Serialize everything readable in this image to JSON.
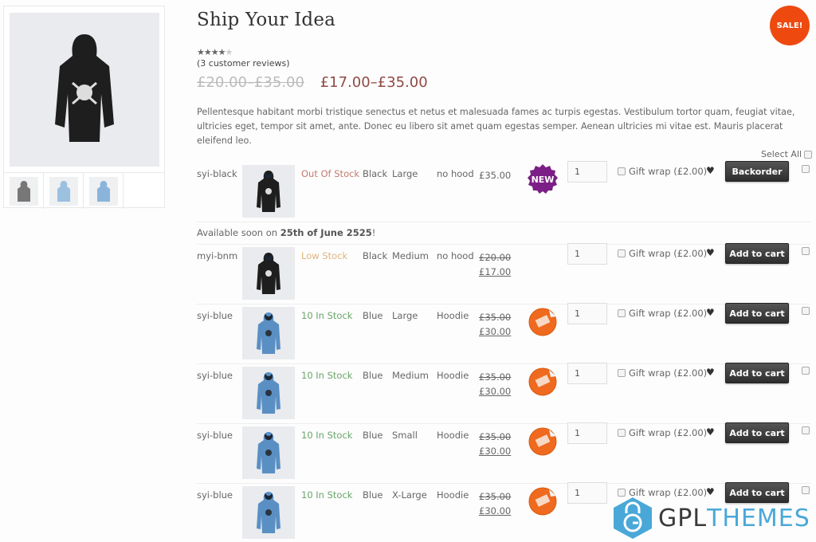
{
  "product": {
    "title": "Ship Your Idea",
    "sale_badge": "SALE!",
    "rating_stars_filled": "★★★★",
    "rating_stars_empty": "★",
    "rating": 4,
    "rating_max": 5,
    "reviews": "(3 customer reviews)",
    "price_old": "£20.00–£35.00",
    "price_new": "£17.00–£35.00",
    "description": "Pellentesque habitant morbi tristique senectus et netus et malesuada fames ac turpis egestas. Vestibulum tortor quam, feugiat vitae, ultricies eget, tempor sit amet, ante. Donec eu libero sit amet quam egestas semper. Aenean ultricies mi vitae est. Mauris placerat eleifend leo."
  },
  "gallery": {
    "main_image": "black-hoodie",
    "thumbs": [
      "grey-hoodie",
      "blue-hoodie",
      "blue-hoodie-2"
    ]
  },
  "table": {
    "select_all_label": "Select All",
    "availability_prefix": "Available soon on ",
    "availability_date": "25th of June 2525",
    "availability_suffix": "!",
    "rows": [
      {
        "sku": "syi-black",
        "image": "black-hoodie",
        "stock": "Out Of Stock",
        "stock_status": "out",
        "color": "Black",
        "size": "Large",
        "style": "no hood",
        "price_regular": "£35.00",
        "price_sale": "",
        "badge": "NEW",
        "qty": "1",
        "gift_label": "Gift wrap (£2.00)",
        "button": "Backorder"
      },
      {
        "sku": "myi-bnm",
        "image": "black-hoodie",
        "stock": "Low Stock",
        "stock_status": "low",
        "color": "Black",
        "size": "Medium",
        "style": "no hood",
        "price_regular": "£20.00",
        "price_sale": "£17.00",
        "badge": "",
        "qty": "1",
        "gift_label": "Gift wrap (£2.00)",
        "button": "Add to cart"
      },
      {
        "sku": "syi-blue",
        "image": "blue-hoodie",
        "stock": "10 In Stock",
        "stock_status": "in",
        "color": "Blue",
        "size": "Large",
        "style": "Hoodie",
        "price_regular": "£35.00",
        "price_sale": "£30.00",
        "badge": "offer",
        "qty": "1",
        "gift_label": "Gift wrap (£2.00)",
        "button": "Add to cart"
      },
      {
        "sku": "syi-blue",
        "image": "blue-hoodie",
        "stock": "10 In Stock",
        "stock_status": "in",
        "color": "Blue",
        "size": "Medium",
        "style": "Hoodie",
        "price_regular": "£35.00",
        "price_sale": "£30.00",
        "badge": "offer",
        "qty": "1",
        "gift_label": "Gift wrap (£2.00)",
        "button": "Add to cart"
      },
      {
        "sku": "syi-blue",
        "image": "blue-hoodie",
        "stock": "10 In Stock",
        "stock_status": "in",
        "color": "Blue",
        "size": "Small",
        "style": "Hoodie",
        "price_regular": "£35.00",
        "price_sale": "£30.00",
        "badge": "offer",
        "qty": "1",
        "gift_label": "Gift wrap (£2.00)",
        "button": "Add to cart"
      },
      {
        "sku": "syi-blue",
        "image": "blue-hoodie",
        "stock": "10 In Stock",
        "stock_status": "in",
        "color": "Blue",
        "size": "X-Large",
        "style": "Hoodie",
        "price_regular": "£35.00",
        "price_sale": "£30.00",
        "badge": "offer",
        "qty": "1",
        "gift_label": "Gift wrap (£2.00)",
        "button": "Add to cart"
      }
    ]
  },
  "watermark": {
    "part1": "GPL",
    "part2": "THEMES"
  },
  "colors": {
    "sale": "#ee4a10",
    "new_badge": "#7b1f86",
    "offer_badge": "#ef6a1e",
    "price_new": "#8f4a45",
    "out_of_stock": "#c27a6f",
    "low_stock": "#e0b57c",
    "in_stock": "#6aa56a",
    "watermark_blue": "#4aa8d8"
  }
}
